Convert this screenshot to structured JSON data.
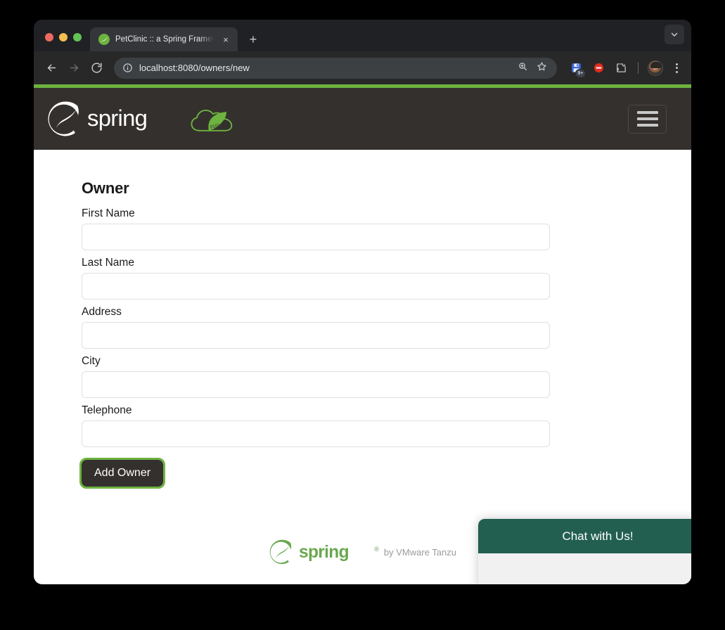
{
  "browser": {
    "window_controls": [
      "close",
      "minimize",
      "maximize"
    ],
    "tab": {
      "title": "PetClinic :: a Spring Framewo",
      "favicon": "spring-leaf-icon",
      "close_label": "×"
    },
    "new_tab_label": "+",
    "tab_list_icon": "chevron-down-icon",
    "nav": {
      "back_icon": "arrow-left-icon",
      "forward_icon": "arrow-right-icon",
      "reload_icon": "reload-icon"
    },
    "omnibox": {
      "url": "localhost:8080/owners/new",
      "site_info_icon": "info-circle-icon",
      "zoom_icon": "search-zoom-icon",
      "bookmark_icon": "star-icon"
    },
    "toolbar_icons": [
      {
        "name": "save-extension-icon",
        "badge": "9+"
      },
      {
        "name": "adblock-icon",
        "badge": ""
      },
      {
        "name": "extensions-puzzle-icon",
        "badge": ""
      }
    ],
    "profile_avatar": "user-avatar",
    "menu_icon": "kebab-menu-icon"
  },
  "site": {
    "brand": {
      "name": "spring",
      "leaf_icon": "spring-leaf-logo",
      "cloud_icon": "spring-cloud-logo",
      "binary_text": "0101"
    },
    "navbar_toggle": "hamburger-menu-icon",
    "colors": {
      "brand_green": "#6db33f",
      "header_dark": "#34302d",
      "chat_teal": "#225f51"
    }
  },
  "form": {
    "title": "Owner",
    "fields": [
      {
        "label": "First Name",
        "value": "",
        "placeholder": "",
        "name": "first-name"
      },
      {
        "label": "Last Name",
        "value": "",
        "placeholder": "",
        "name": "last-name"
      },
      {
        "label": "Address",
        "value": "",
        "placeholder": "",
        "name": "address"
      },
      {
        "label": "City",
        "value": "",
        "placeholder": "",
        "name": "city"
      },
      {
        "label": "Telephone",
        "value": "",
        "placeholder": "",
        "name": "telephone"
      }
    ],
    "submit_label": "Add Owner"
  },
  "footer": {
    "brand": "spring",
    "trademark": "®",
    "attribution": "by VMware Tanzu"
  },
  "chat": {
    "header": "Chat with Us!"
  }
}
